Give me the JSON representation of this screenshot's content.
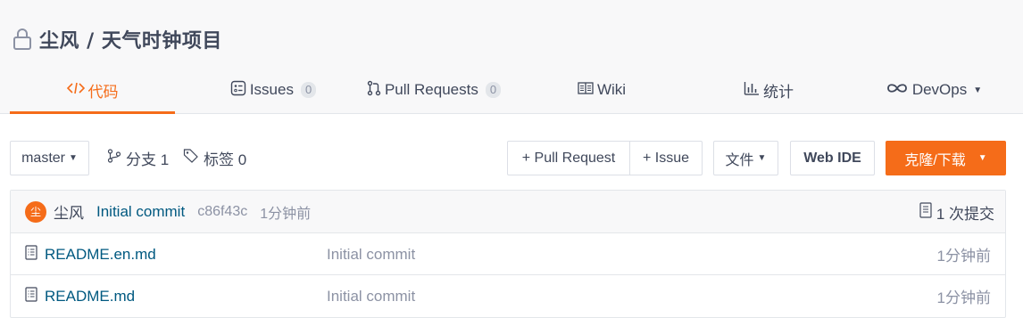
{
  "repo": {
    "title": "尘风 / 天气时钟项目"
  },
  "tabs": [
    {
      "label": "代码",
      "icon": "code-icon",
      "active": true
    },
    {
      "label": "Issues",
      "icon": "issues-icon",
      "badge": "0"
    },
    {
      "label": "Pull Requests",
      "icon": "pull-request-icon",
      "badge": "0"
    },
    {
      "label": "Wiki",
      "icon": "wiki-icon"
    },
    {
      "label": "统计",
      "icon": "chart-icon"
    },
    {
      "label": "DevOps",
      "icon": "infinity-icon"
    }
  ],
  "toolbar": {
    "branch": "master",
    "branches_label": "分支 1",
    "tags_label": "标签 0",
    "pull_request_btn": "+ Pull Request",
    "issue_btn": "+ Issue",
    "file_btn": "文件",
    "web_ide_btn": "Web IDE",
    "clone_btn": "克隆/下载"
  },
  "commit": {
    "avatar_text": "尘",
    "author": "尘风",
    "message": "Initial commit",
    "hash": "c86f43c",
    "time": "1分钟前",
    "count_label": "1 次提交"
  },
  "files": [
    {
      "name": "README.en.md",
      "commit": "Initial commit",
      "time": "1分钟前"
    },
    {
      "name": "README.md",
      "commit": "Initial commit",
      "time": "1分钟前"
    }
  ],
  "colors": {
    "accent": "#f56c19",
    "link": "#005980",
    "muted": "#8c92a4",
    "text": "#40485b"
  }
}
